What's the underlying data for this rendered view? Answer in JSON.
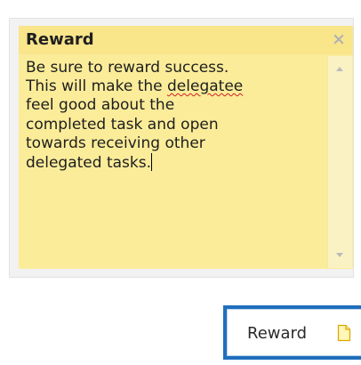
{
  "note": {
    "title": "Reward",
    "close_symbol": "×",
    "text_before": "Be sure to reward success.\nThis will make the ",
    "misspelled_word": "delegatee",
    "text_after": "\nfeel good about the\ncompleted task and open\ntowards receiving other\ndelegated tasks.",
    "background_color": "#fbec9a",
    "header_color": "#f9e58a"
  },
  "scrollbar": {
    "up_icon": "arrow-up-icon",
    "down_icon": "arrow-down-icon"
  },
  "reward_button": {
    "label": "Reward",
    "icon": "sticky-note-icon",
    "border_color": "#1f6fbd"
  }
}
